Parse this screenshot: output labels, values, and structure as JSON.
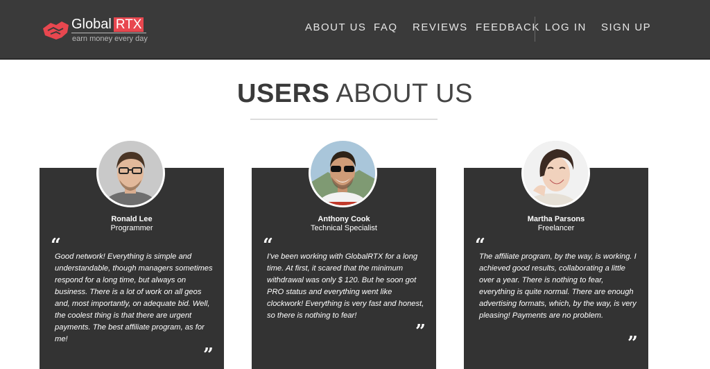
{
  "brand": {
    "name_main": "Global",
    "name_accent": "RTX",
    "tagline": "earn money every day",
    "accent_color": "#e8474f"
  },
  "nav": {
    "about": "ABOUT US",
    "faq": "FAQ",
    "reviews": "REVIEWS",
    "feedback": "FEEDBACK",
    "login": "LOG IN",
    "signup": "SIGN UP"
  },
  "section": {
    "title_bold": "USERS",
    "title_light": "ABOUT US"
  },
  "quote_marks": {
    "open": "“",
    "close": "”"
  },
  "reviews": [
    {
      "name": "Ronald Lee",
      "role": "Programmer",
      "text": "Good network! Everything is simple and understandable, though managers sometimes respond for a long time, but always on business. There is a lot of work on all geos and, most importantly, on adequate bid. Well, the coolest thing is that there are urgent payments. The best affiliate program, as for me!"
    },
    {
      "name": "Anthony Cook",
      "role": "Technical Specialist",
      "text": "I've been working with GlobalRTX for a long time. At first, it scared that the minimum withdrawal was only $ 120. But he soon got PRO status and everything went like clockwork! Everything is very fast and honest, so there is nothing to fear!"
    },
    {
      "name": "Martha Parsons",
      "role": "Freelancer",
      "text": "The affiliate program, by the way, is working. I achieved good results, collaborating a little over a year. There is nothing to fear, everything is quite normal. There are enough advertising formats, which, by the way, is very pleasing! Payments are no problem."
    }
  ]
}
